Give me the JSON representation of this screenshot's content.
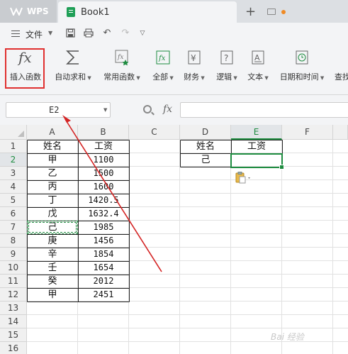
{
  "titlebar": {
    "app_tab": "WPS",
    "doc_tab": "Book1"
  },
  "menubar": {
    "file_label": "文件"
  },
  "ribbon": {
    "buttons": [
      {
        "label": "插入函数",
        "icon": "fx-icon"
      },
      {
        "label": "自动求和",
        "icon": "sigma-icon"
      },
      {
        "label": "常用函数",
        "icon": "star-fx-icon"
      },
      {
        "label": "全部",
        "icon": "fx-box-icon"
      },
      {
        "label": "财务",
        "icon": "yen-icon"
      },
      {
        "label": "逻辑",
        "icon": "question-icon"
      },
      {
        "label": "文本",
        "icon": "text-a-icon"
      },
      {
        "label": "日期和时间",
        "icon": "clock-icon"
      },
      {
        "label": "查找",
        "icon": "lookup-icon"
      }
    ],
    "highlight_color": "#e03030"
  },
  "formula_bar": {
    "name_box": "E2",
    "fx_label": "fx",
    "formula": ""
  },
  "sheet": {
    "columns": [
      "A",
      "B",
      "C",
      "D",
      "E",
      "F"
    ],
    "rows": [
      "1",
      "2",
      "3",
      "4",
      "5",
      "6",
      "7",
      "8",
      "9",
      "10",
      "11",
      "12",
      "13",
      "14",
      "15",
      "16"
    ],
    "selected_column": "E",
    "selected_row": "2",
    "table_main": {
      "headers": [
        "姓名",
        "工资"
      ],
      "names": [
        "甲",
        "乙",
        "丙",
        "丁",
        "戊",
        "己",
        "庚",
        "辛",
        "壬",
        "癸",
        "甲"
      ],
      "salaries": [
        "1100",
        "1500",
        "1600",
        "1420.5",
        "1632.4",
        "1985",
        "1456",
        "1854",
        "1654",
        "2012",
        "2451"
      ]
    },
    "table_lookup": {
      "headers": [
        "姓名",
        "工资"
      ],
      "name": "己",
      "salary": ""
    },
    "accent_color": "#1e8c40"
  },
  "watermark": "Bai 经验"
}
